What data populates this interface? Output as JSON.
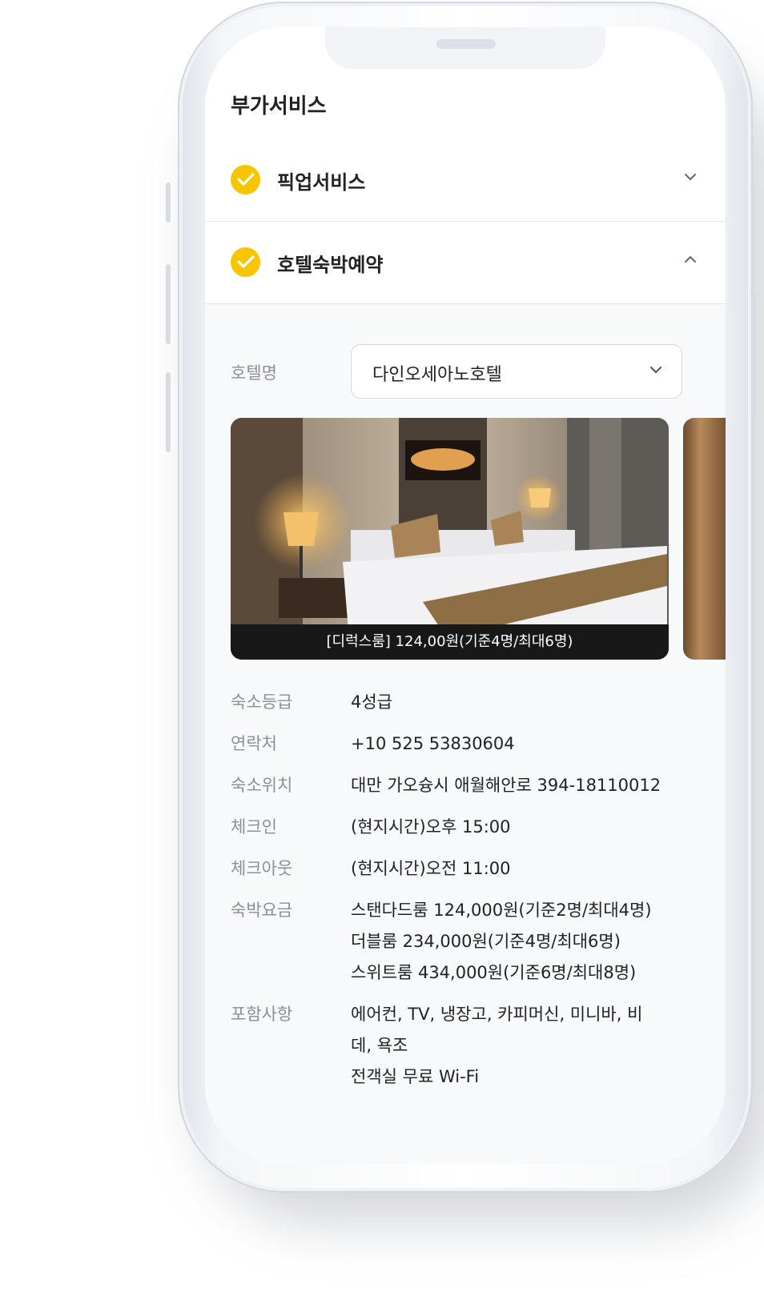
{
  "section_title": "부가서비스",
  "accordions": [
    {
      "label": "픽업서비스",
      "expanded": false
    },
    {
      "label": "호텔숙박예약",
      "expanded": true
    }
  ],
  "hotel": {
    "field_label": "호텔명",
    "selected": "다인오세아노호텔",
    "photo_caption": "[디럭스룸] 124,00원(기준4명/최대6명)"
  },
  "details": [
    {
      "key": "숙소등급",
      "lines": [
        "4성급"
      ]
    },
    {
      "key": "연락처",
      "lines": [
        "+10 525 53830604"
      ]
    },
    {
      "key": "숙소위치",
      "lines": [
        "대만 가오슝시 애월해안로 394-18110012"
      ]
    },
    {
      "key": "체크인",
      "lines": [
        "(현지시간)오후 15:00"
      ]
    },
    {
      "key": "체크아웃",
      "lines": [
        "(현지시간)오전 11:00"
      ]
    },
    {
      "key": "숙박요금",
      "lines": [
        "스탠다드룸 124,000원(기준2명/최대4명)",
        "더블룸 234,000원(기준4명/최대6명)",
        "스위트룸 434,000원(기준6명/최대8명)"
      ]
    },
    {
      "key": "포함사항",
      "lines": [
        "에어컨, TV, 냉장고, 카피머신, 미니바, 비",
        "데, 욕조",
        "전객실 무료 Wi-Fi"
      ]
    }
  ],
  "colors": {
    "accent": "#f7c600",
    "label": "#8a8f98",
    "text": "#222222"
  }
}
